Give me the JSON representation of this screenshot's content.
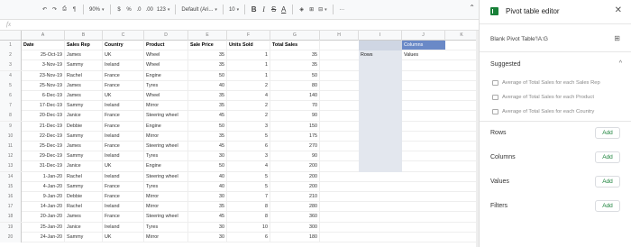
{
  "toolbar": {
    "zoom": "90%",
    "currency": "$",
    "percent": "%",
    "dec_decrease": ".0",
    "dec_increase": ".00",
    "number_format": "123",
    "font": "Default (Ari...",
    "font_size": "10",
    "bold": "B",
    "italic": "I",
    "strike": "S",
    "text_color": "A",
    "more": "···"
  },
  "formula_bar": {
    "fx": "fx"
  },
  "columns": [
    "A",
    "B",
    "C",
    "D",
    "E",
    "F",
    "G",
    "H",
    "I",
    "J",
    "K"
  ],
  "headers": [
    "Date",
    "Sales Rep",
    "Country",
    "Product",
    "Sale Price",
    "Units Sold",
    "Total Sales"
  ],
  "rows": [
    [
      "25-Oct-19",
      "James",
      "UK",
      "Wheel",
      "35",
      "1",
      "35"
    ],
    [
      "3-Nov-19",
      "Sammy",
      "Ireland",
      "Wheel",
      "35",
      "1",
      "35"
    ],
    [
      "23-Nov-19",
      "Rachel",
      "France",
      "Engine",
      "50",
      "1",
      "50"
    ],
    [
      "25-Nov-19",
      "James",
      "France",
      "Tyres",
      "40",
      "2",
      "80"
    ],
    [
      "6-Dec-19",
      "James",
      "UK",
      "Wheel",
      "35",
      "4",
      "140"
    ],
    [
      "17-Dec-19",
      "Sammy",
      "Ireland",
      "Mirror",
      "35",
      "2",
      "70"
    ],
    [
      "20-Dec-19",
      "Janice",
      "France",
      "Steering wheel",
      "45",
      "2",
      "90"
    ],
    [
      "21-Dec-19",
      "Debbie",
      "France",
      "Engine",
      "50",
      "3",
      "150"
    ],
    [
      "22-Dec-19",
      "Sammy",
      "Ireland",
      "Mirror",
      "35",
      "5",
      "175"
    ],
    [
      "25-Dec-19",
      "James",
      "France",
      "Steering wheel",
      "45",
      "6",
      "270"
    ],
    [
      "29-Dec-19",
      "Sammy",
      "Ireland",
      "Tyres",
      "30",
      "3",
      "90"
    ],
    [
      "31-Dec-19",
      "Janice",
      "UK",
      "Engine",
      "50",
      "4",
      "200"
    ],
    [
      "1-Jan-20",
      "Rachel",
      "Ireland",
      "Steering wheel",
      "40",
      "5",
      "200"
    ],
    [
      "4-Jan-20",
      "Sammy",
      "France",
      "Tyres",
      "40",
      "5",
      "200"
    ],
    [
      "9-Jan-20",
      "Debbie",
      "France",
      "Mirror",
      "30",
      "7",
      "210"
    ],
    [
      "14-Jan-20",
      "Rachel",
      "Ireland",
      "Mirror",
      "35",
      "8",
      "280"
    ],
    [
      "20-Jan-20",
      "James",
      "France",
      "Steering wheel",
      "45",
      "8",
      "360"
    ],
    [
      "25-Jan-20",
      "Janice",
      "Ireland",
      "Tyres",
      "30",
      "10",
      "300"
    ],
    [
      "24-Jan-20",
      "Sammy",
      "UK",
      "Mirror",
      "30",
      "6",
      "180"
    ]
  ],
  "pivot_cells": {
    "columns": "Columns",
    "rows": "Rows",
    "values": "Values"
  },
  "panel": {
    "title": "Pivot table editor",
    "close": "✕",
    "range": "Blank Pivot Table'!A:G",
    "suggested": "Suggested",
    "suggestions": [
      "Average of Total Sales for each Sales Rep",
      "Average of Total Sales for each Product",
      "Average of Total Sales for each Country"
    ],
    "sections": [
      "Rows",
      "Columns",
      "Values",
      "Filters"
    ],
    "add_label": "Add"
  },
  "colors": {
    "accent": "#188038",
    "pivot_bg": "#e3e7ee",
    "pivot_sel": "#6a89c7"
  }
}
